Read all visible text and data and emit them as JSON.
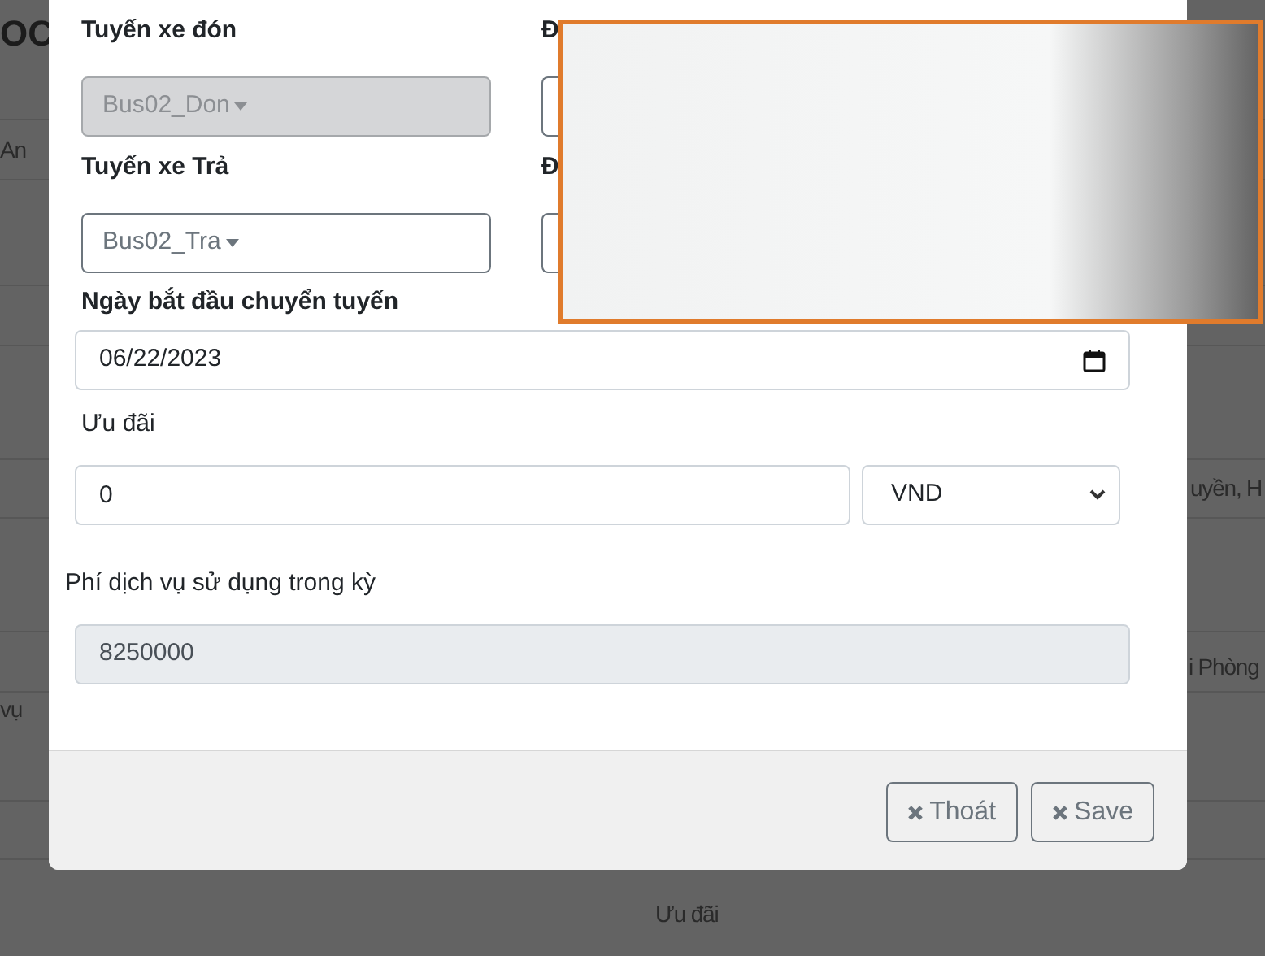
{
  "background_page": {
    "title": "OC",
    "texts": [
      "An",
      "uyền, H",
      "i Phòng",
      "vụ",
      "Ưu đãi"
    ]
  },
  "modal": {
    "route_fields": [
      {
        "label": "Tuyến xe đón",
        "value": "Bus02_Don",
        "disabled": true
      },
      {
        "label": "Đ"
      },
      {
        "label": "Tuyến xe Trả",
        "value": "Bus02_Tra",
        "disabled": false
      },
      {
        "label": "Đ"
      }
    ],
    "start_date": {
      "label": "Ngày bắt đầu chuyển tuyến",
      "value": "06/22/2023"
    },
    "discount": {
      "label": "Ưu đãi",
      "value": "0",
      "currency": "VND"
    },
    "service_fee": {
      "label": "Phí dịch vụ sử dụng trong kỳ",
      "value": "8250000",
      "readonly": true
    },
    "buttons": [
      {
        "label": "Thoát"
      },
      {
        "label": "Save"
      }
    ]
  }
}
